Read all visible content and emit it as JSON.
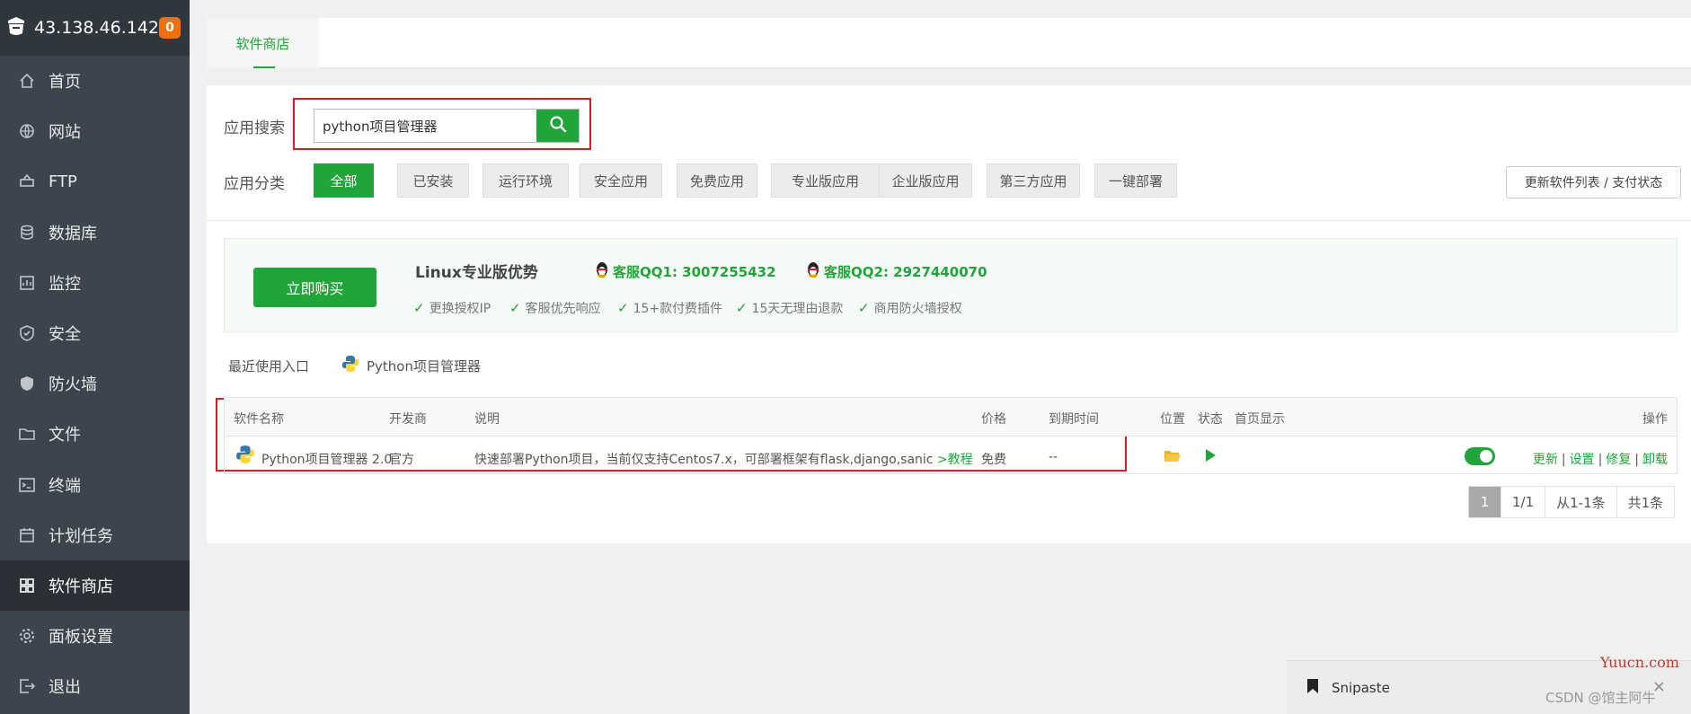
{
  "sidebar": {
    "server_ip": "43.138.46.142",
    "badge_count": "0",
    "items": [
      {
        "label": "首页",
        "icon": "home-icon"
      },
      {
        "label": "网站",
        "icon": "globe-icon"
      },
      {
        "label": "FTP",
        "icon": "ftp-icon"
      },
      {
        "label": "数据库",
        "icon": "database-icon"
      },
      {
        "label": "监控",
        "icon": "monitor-icon"
      },
      {
        "label": "安全",
        "icon": "shield-check-icon"
      },
      {
        "label": "防火墙",
        "icon": "firewall-shield-icon"
      },
      {
        "label": "文件",
        "icon": "folder-icon"
      },
      {
        "label": "终端",
        "icon": "terminal-icon"
      },
      {
        "label": "计划任务",
        "icon": "calendar-icon"
      },
      {
        "label": "软件商店",
        "icon": "grid-apps-icon",
        "active": true
      },
      {
        "label": "面板设置",
        "icon": "gear-icon"
      },
      {
        "label": "退出",
        "icon": "logout-icon"
      }
    ]
  },
  "tabbar": {
    "tab_label": "软件商店"
  },
  "search": {
    "label": "应用搜索",
    "value": "python项目管理器"
  },
  "categories": {
    "label": "应用分类",
    "items": [
      "全部",
      "已安装",
      "运行环境",
      "安全应用",
      "免费应用",
      "专业版应用",
      "企业版应用",
      "第三方应用",
      "一键部署"
    ],
    "refresh_label": "更新软件列表 / 支付状态"
  },
  "promo": {
    "buy_label": "立即购买",
    "title": "Linux专业版优势",
    "qq1": "客服QQ1: 3007255432",
    "qq2": "客服QQ2: 2927440070",
    "features": [
      "更换授权IP",
      "客服优先响应",
      "15+款付费插件",
      "15天无理由退款",
      "商用防火墙授权"
    ]
  },
  "recent": {
    "label": "最近使用入口",
    "item": "Python项目管理器"
  },
  "table": {
    "headers": {
      "name": "软件名称",
      "developer": "开发商",
      "desc": "说明",
      "price": "价格",
      "expire": "到期时间",
      "location": "位置",
      "status": "状态",
      "homepage": "首页显示",
      "ops": "操作"
    },
    "row": {
      "name": "Python项目管理器 2.0",
      "developer": "官方",
      "desc": "快速部署Python项目，当前仅支持Centos7.x，可部署框架有flask,django,sanic",
      "tutorial": ">教程",
      "price": "免费",
      "expire": "--",
      "homepage_on": true,
      "ops": [
        "更新",
        "设置",
        "修复",
        "卸载"
      ]
    }
  },
  "pager": {
    "current": "1",
    "pages": "1/1",
    "range": "从1-1条",
    "total": "共1条"
  },
  "snipaste": {
    "label": "Snipaste",
    "close": "×"
  },
  "watermarks": {
    "site": "Yuucn.com",
    "author": "CSDN @馆主阿牛"
  },
  "colors": {
    "accent": "#20a53a",
    "sidebar_bg": "#3c444d",
    "highlight_red": "#e0182a",
    "badge": "#f0700f"
  }
}
